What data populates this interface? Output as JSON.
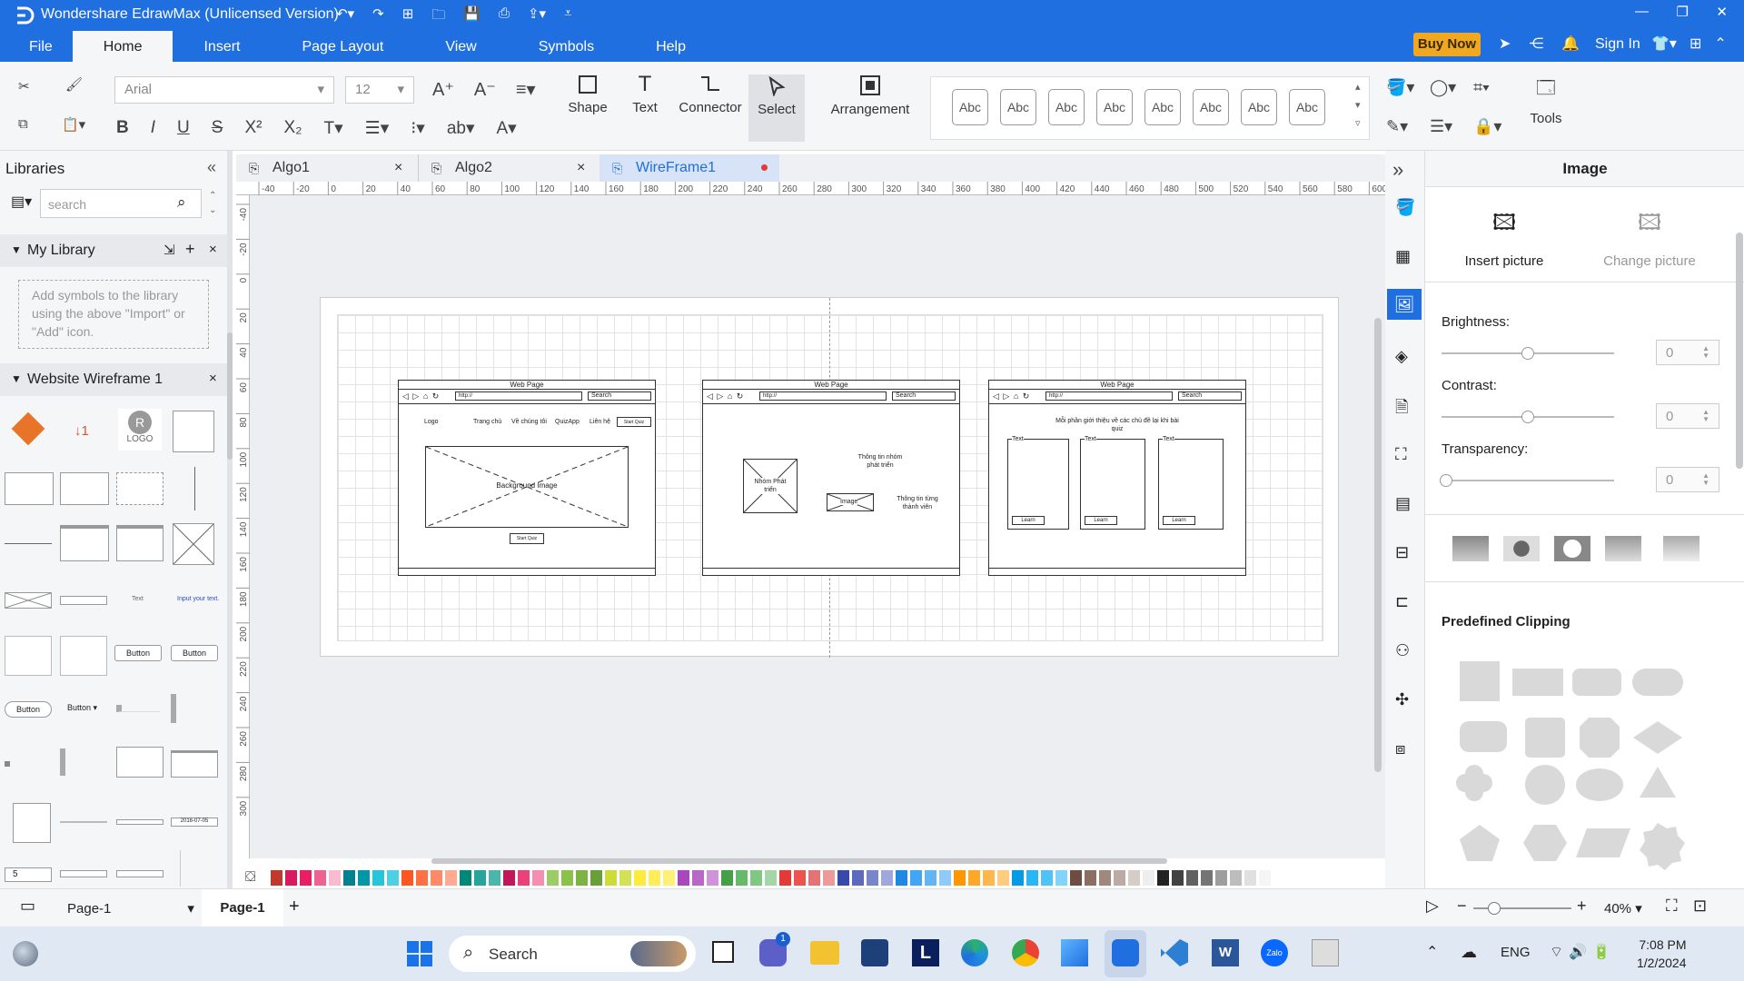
{
  "app": {
    "title": "Wondershare EdrawMax (Unlicensed Version)",
    "buy_now": "Buy Now",
    "sign_in": "Sign In"
  },
  "menu": {
    "tabs": [
      "File",
      "Home",
      "Insert",
      "Page Layout",
      "View",
      "Symbols",
      "Help"
    ],
    "active": "Home"
  },
  "ribbon": {
    "font_name": "Arial",
    "font_size": "12",
    "shape_label": "Shape",
    "text_label": "Text",
    "connector_label": "Connector",
    "select_label": "Select",
    "arrangement_label": "Arrangement",
    "tools_label": "Tools",
    "style_swatches": [
      "Abc",
      "Abc",
      "Abc",
      "Abc",
      "Abc",
      "Abc",
      "Abc",
      "Abc"
    ]
  },
  "libraries": {
    "title": "Libraries",
    "search_placeholder": "search",
    "my_library": {
      "title": "My Library",
      "empty_text": "Add symbols to the library using the above \"Import\" or \"Add\" icon."
    },
    "website_wireframe": {
      "title": "Website Wireframe 1",
      "logo_label": "LOGO",
      "button_labels": [
        "Button",
        "Button",
        "Button",
        "Button"
      ],
      "stepper_value": "5",
      "date_value": "2016-07-05"
    }
  },
  "doc_tabs": [
    {
      "label": "Algo1",
      "active": false
    },
    {
      "label": "Algo2",
      "active": false
    },
    {
      "label": "WireFrame1",
      "active": true
    }
  ],
  "ruler": {
    "h_ticks": [
      "-40",
      "-20",
      "0",
      "20",
      "40",
      "60",
      "80",
      "100",
      "120",
      "140",
      "160",
      "180",
      "200",
      "220",
      "240",
      "260",
      "280",
      "300",
      "320",
      "340",
      "360",
      "380",
      "400",
      "420",
      "440",
      "460",
      "480",
      "500",
      "520",
      "540",
      "560",
      "580",
      "600"
    ],
    "v_ticks": [
      "-40",
      "-20",
      "0",
      "20",
      "40",
      "60",
      "80",
      "100",
      "120",
      "140",
      "160",
      "180",
      "200",
      "220",
      "240",
      "260",
      "280",
      "300"
    ]
  },
  "wireframes": [
    {
      "title": "Web Page",
      "url": "http://",
      "search": "Search",
      "nav": [
        "Logo",
        "Trang chủ",
        "Về chúng tôi",
        "QuizApp",
        "Liên hệ"
      ],
      "nav_button": "Start Quiz",
      "hero": "Background Image",
      "cta": "Start Quiz"
    },
    {
      "title": "Web Page",
      "url": "http://",
      "search": "Search",
      "left_image": "Nhóm Phát triển",
      "info1": "Thông tin nhóm phát triển",
      "image_label": "Image",
      "info2": "Thông tin từng thành viên"
    },
    {
      "title": "Web Page",
      "url": "http://",
      "search": "Search",
      "heading": "Mỗi phần giới thiệu về các chủ đề lại khi bài quiz",
      "card_text": "Text",
      "card_button": "Learn"
    }
  ],
  "right_panel": {
    "title": "Image",
    "insert_picture": "Insert picture",
    "change_picture": "Change picture",
    "brightness_label": "Brightness:",
    "brightness_value": "0",
    "brightness": 0.5,
    "contrast_label": "Contrast:",
    "contrast_value": "0",
    "contrast": 0.5,
    "transparency_label": "Transparency:",
    "transparency_value": "0",
    "transparency": 0,
    "predefined_clipping": "Predefined Clipping"
  },
  "status": {
    "page_name": "Page-1",
    "page_tab": "Page-1",
    "zoom": "40%",
    "zoom_level": 0.4
  },
  "taskbar": {
    "search": "Search",
    "language": "ENG",
    "time": "7:08 PM",
    "date": "1/2/2024",
    "badge": "1"
  },
  "colors": {
    "accent": "#1f6fe0",
    "buy_now_bg": "#f0a820",
    "record_dot": "#e53935"
  }
}
